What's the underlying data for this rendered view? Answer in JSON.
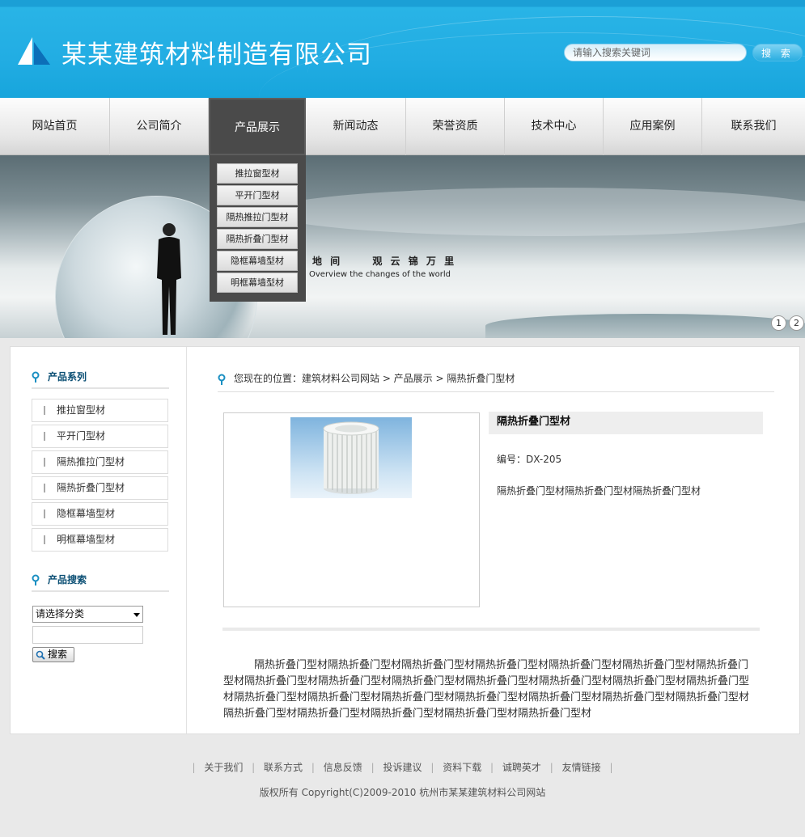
{
  "header": {
    "company_name": "某某建筑材料制造有限公司",
    "search_placeholder": "请输入搜索关键词",
    "search_button": "搜 索"
  },
  "nav": {
    "items": [
      "网站首页",
      "公司简介",
      "产品展示",
      "新闻动态",
      "荣誉资质",
      "技术中心",
      "应用案例",
      "联系我们"
    ],
    "active": "产品展示"
  },
  "dropdown": {
    "items": [
      "推拉窗型材",
      "平开门型材",
      "隔热推拉门型材",
      "隔热折叠门型材",
      "隐框幕墙型材",
      "明框幕墙型材"
    ]
  },
  "banner": {
    "slogan": "地 间　　 观 云 锦 万 里",
    "slogan_en": "Overview the changes of the world",
    "pages": [
      "1",
      "2"
    ]
  },
  "sidebar": {
    "series_title": "产品系列",
    "series_items": [
      "推拉窗型材",
      "平开门型材",
      "隔热推拉门型材",
      "隔热折叠门型材",
      "隐框幕墙型材",
      "明框幕墙型材"
    ],
    "search_title": "产品搜索",
    "select_value": "请选择分类",
    "search_button": "搜索"
  },
  "breadcrumb": {
    "text": "您现在的位置：建筑材料公司网站  > 产品展示  > 隔热折叠门型材"
  },
  "product": {
    "title": "隔热折叠门型材",
    "code": "编号：DX-205",
    "summary": "隔热折叠门型材隔热折叠门型材隔热折叠门型材",
    "description": "隔热折叠门型材隔热折叠门型材隔热折叠门型材隔热折叠门型材隔热折叠门型材隔热折叠门型材隔热折叠门型材隔热折叠门型材隔热折叠门型材隔热折叠门型材隔热折叠门型材隔热折叠门型材隔热折叠门型材隔热折叠门型材隔热折叠门型材隔热折叠门型材隔热折叠门型材隔热折叠门型材隔热折叠门型材隔热折叠门型材隔热折叠门型材隔热折叠门型材隔热折叠门型材隔热折叠门型材隔热折叠门型材隔热折叠门型材"
  },
  "footer": {
    "links": [
      "关于我们",
      "联系方式",
      "信息反馈",
      "投诉建议",
      "资料下载",
      "诚聘英才",
      "友情链接"
    ],
    "copyright": "版权所有  Copyright(C)2009-2010 杭州市某某建筑材料公司网站"
  }
}
